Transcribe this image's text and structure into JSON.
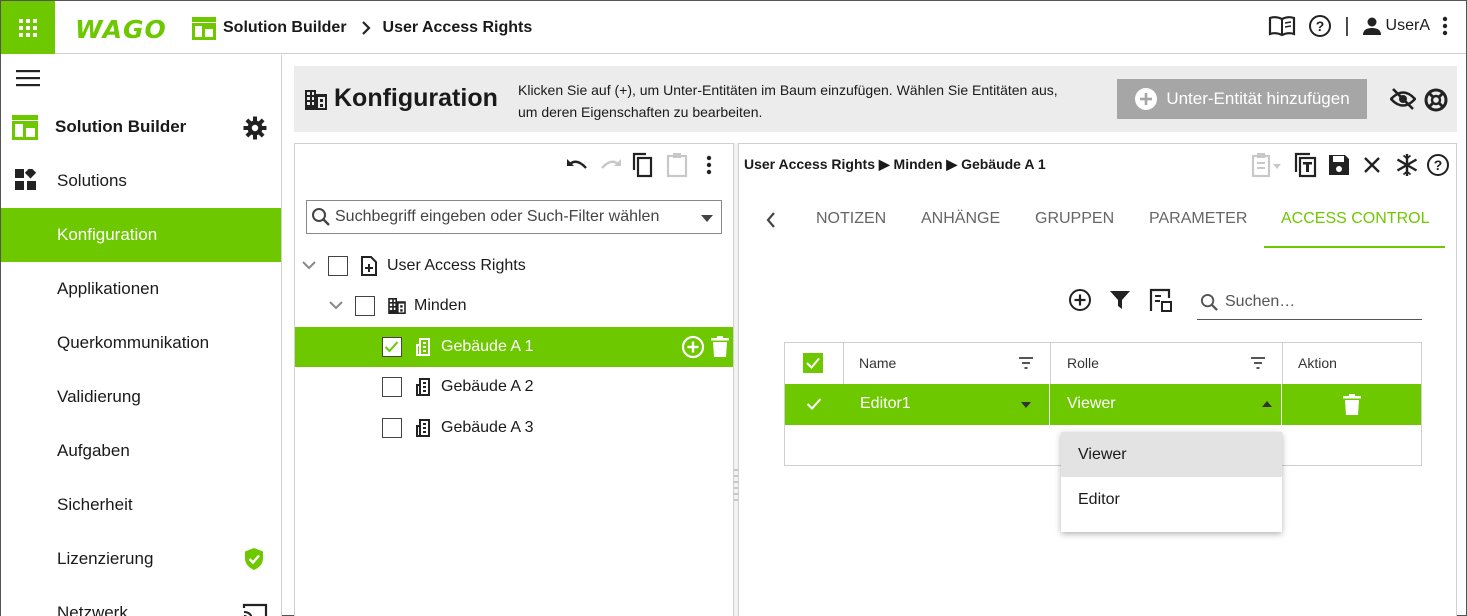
{
  "topbar": {
    "logo_text": "WAGO",
    "breadcrumb": [
      "Solution Builder",
      "User Access Rights"
    ],
    "user_name": "UserA",
    "separator": "|"
  },
  "sidebar": {
    "app_title": "Solution Builder",
    "items": [
      {
        "label": "Solutions",
        "icon": "dashboard-icon"
      },
      {
        "label": "Konfiguration",
        "active": true
      },
      {
        "label": "Applikationen"
      },
      {
        "label": "Querkommunikation"
      },
      {
        "label": "Validierung"
      },
      {
        "label": "Aufgaben"
      },
      {
        "label": "Sicherheit"
      },
      {
        "label": "Lizenzierung",
        "icon": "shield-check-icon"
      },
      {
        "label": "Netzwerk",
        "icon": "cast-icon"
      }
    ]
  },
  "config": {
    "title": "Konfiguration",
    "description_line1": "Klicken Sie auf (+), um Unter-Entitäten im Baum einzufügen. Wählen Sie Entitäten aus,",
    "description_line2": "um deren Eigenschaften zu bearbeiten.",
    "add_button_label": "Unter-Entität hinzufügen"
  },
  "tree": {
    "search_placeholder": "Suchbegriff eingeben oder Such-Filter wählen",
    "nodes": [
      {
        "label": "User Access Rights",
        "checked": false
      },
      {
        "label": "Minden",
        "checked": false
      },
      {
        "label": "Gebäude A 1",
        "checked": true,
        "selected": true
      },
      {
        "label": "Gebäude A 2",
        "checked": false
      },
      {
        "label": "Gebäude A 3",
        "checked": false
      }
    ]
  },
  "detail": {
    "breadcrumb": "User Access Rights ▶ Minden ▶ Gebäude A 1",
    "tabs": [
      "NOTIZEN",
      "ANHÄNGE",
      "GRUPPEN",
      "PARAMETER",
      "ACCESS CONTROL"
    ],
    "active_tab": "ACCESS CONTROL",
    "search_placeholder": "Suchen…",
    "table": {
      "columns": [
        "Name",
        "Rolle",
        "Aktion"
      ],
      "rows": [
        {
          "name": "Editor1",
          "role": "Viewer"
        }
      ]
    },
    "role_options": [
      "Viewer",
      "Editor"
    ]
  },
  "colors": {
    "accent": "#6ec800",
    "header_bg": "#ececec",
    "disabled_button": "#a6a6a6"
  }
}
